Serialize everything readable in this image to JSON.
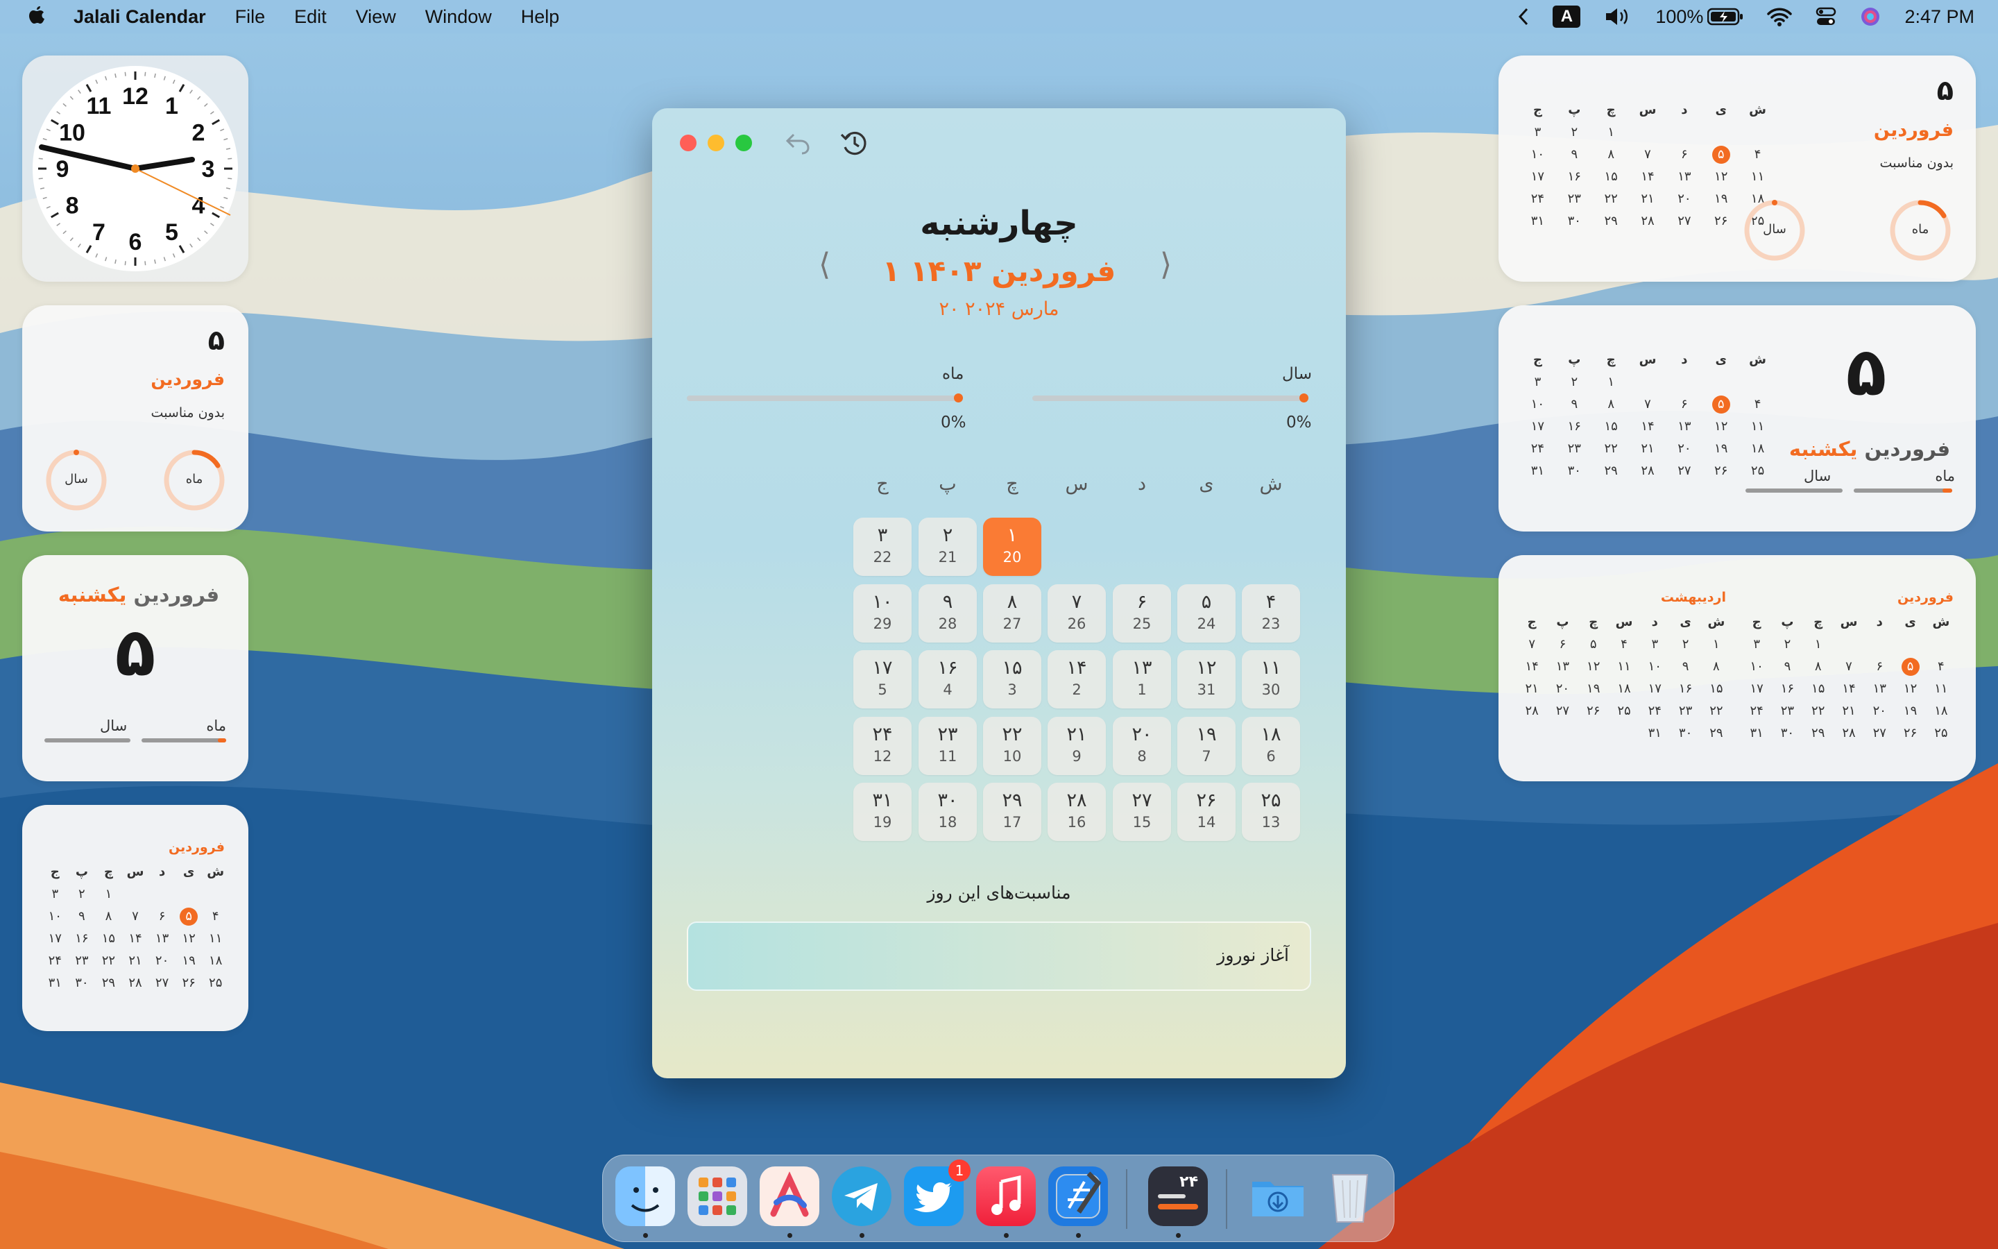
{
  "menubar": {
    "app_name": "Jalali Calendar",
    "menus": [
      "File",
      "Edit",
      "View",
      "Window",
      "Help"
    ],
    "input_indicator": "A",
    "battery": "100%",
    "time": "2:47 PM"
  },
  "clock": {
    "numbers": [
      "12",
      "1",
      "2",
      "3",
      "4",
      "5",
      "6",
      "7",
      "8",
      "9",
      "10",
      "11"
    ]
  },
  "common": {
    "month": "فروردین",
    "month2": "اردیبهشت",
    "weekday": "یکشنبه",
    "day": "۵",
    "no_event": "بدون مناسبت",
    "ring_month": "ماه",
    "ring_year": "سال"
  },
  "mini_grid": {
    "headers": [
      "ش",
      "ی",
      "د",
      "س",
      "چ",
      "پ",
      "ج"
    ],
    "farvardin": [
      [
        "",
        "",
        "",
        "",
        "۱",
        "۲",
        "۳"
      ],
      [
        "۴",
        "۵",
        "۶",
        "۷",
        "۸",
        "۹",
        "۱۰"
      ],
      [
        "۱۱",
        "۱۲",
        "۱۳",
        "۱۴",
        "۱۵",
        "۱۶",
        "۱۷"
      ],
      [
        "۱۸",
        "۱۹",
        "۲۰",
        "۲۱",
        "۲۲",
        "۲۳",
        "۲۴"
      ],
      [
        "۲۵",
        "۲۶",
        "۲۷",
        "۲۸",
        "۲۹",
        "۳۰",
        "۳۱"
      ]
    ],
    "ordibehesht": [
      [
        "۱",
        "۲",
        "۳",
        "۴",
        "۵",
        "۶",
        "۷"
      ],
      [
        "۸",
        "۹",
        "۱۰",
        "۱۱",
        "۱۲",
        "۱۳",
        "۱۴"
      ],
      [
        "۱۵",
        "۱۶",
        "۱۷",
        "۱۸",
        "۱۹",
        "۲۰",
        "۲۱"
      ],
      [
        "۲۲",
        "۲۳",
        "۲۴",
        "۲۵",
        "۲۶",
        "۲۷",
        "۲۸"
      ],
      [
        "۲۹",
        "۳۰",
        "۳۱",
        "",
        "",
        "",
        ""
      ]
    ],
    "today": "۵"
  },
  "main": {
    "weekday": "چهارشنبه",
    "date": "۱ فروردین ۱۴۰۳",
    "gregorian": "۲۰ مارس ۲۰۲۴",
    "prev_arrow": "⟨",
    "next_arrow": "⟩",
    "year_label": "سال",
    "month_label": "ماه",
    "year_pct": "0%",
    "month_pct": "0%",
    "weekdays": [
      "ش",
      "ی",
      "د",
      "س",
      "چ",
      "پ",
      "ج"
    ],
    "days": [
      {
        "p": "۱",
        "g": "20",
        "sel": true
      },
      {
        "p": "۲",
        "g": "21"
      },
      {
        "p": "۳",
        "g": "22"
      },
      {
        "p": "۴",
        "g": "23"
      },
      {
        "p": "۵",
        "g": "24"
      },
      {
        "p": "۶",
        "g": "25"
      },
      {
        "p": "۷",
        "g": "26"
      },
      {
        "p": "۸",
        "g": "27"
      },
      {
        "p": "۹",
        "g": "28"
      },
      {
        "p": "۱۰",
        "g": "29"
      },
      {
        "p": "۱۱",
        "g": "30"
      },
      {
        "p": "۱۲",
        "g": "31"
      },
      {
        "p": "۱۳",
        "g": "1"
      },
      {
        "p": "۱۴",
        "g": "2"
      },
      {
        "p": "۱۵",
        "g": "3"
      },
      {
        "p": "۱۶",
        "g": "4"
      },
      {
        "p": "۱۷",
        "g": "5"
      },
      {
        "p": "۱۸",
        "g": "6"
      },
      {
        "p": "۱۹",
        "g": "7"
      },
      {
        "p": "۲۰",
        "g": "8"
      },
      {
        "p": "۲۱",
        "g": "9"
      },
      {
        "p": "۲۲",
        "g": "10"
      },
      {
        "p": "۲۳",
        "g": "11"
      },
      {
        "p": "۲۴",
        "g": "12"
      },
      {
        "p": "۲۵",
        "g": "13"
      },
      {
        "p": "۲۶",
        "g": "14"
      },
      {
        "p": "۲۷",
        "g": "15"
      },
      {
        "p": "۲۸",
        "g": "16"
      },
      {
        "p": "۲۹",
        "g": "17"
      },
      {
        "p": "۳۰",
        "g": "18"
      },
      {
        "p": "۳۱",
        "g": "19"
      }
    ],
    "events_title": "مناسبت‌های این روز",
    "event": "آغاز نوروز"
  },
  "dock": {
    "twitter_badge": "1",
    "app_badge": "۲۴"
  },
  "colors": {
    "accent": "#f26b21"
  }
}
